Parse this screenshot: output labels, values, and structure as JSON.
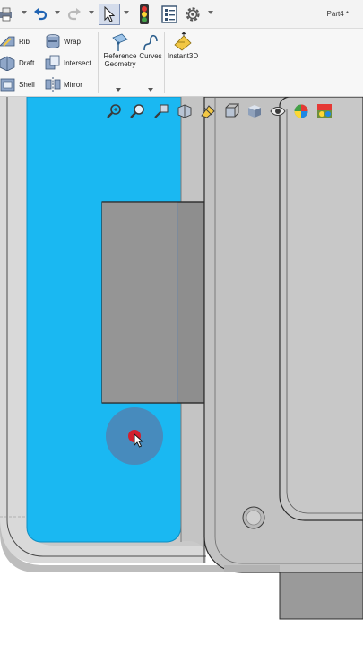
{
  "window": {
    "document_title": "Part4 *"
  },
  "toolbar": {
    "items": [
      {
        "name": "print-icon"
      },
      {
        "name": "undo-icon"
      },
      {
        "name": "redo-icon"
      },
      {
        "name": "select-icon"
      },
      {
        "name": "rebuild-icon"
      },
      {
        "name": "file-properties-icon"
      },
      {
        "name": "options-gear-icon"
      }
    ]
  },
  "ribbon": {
    "rib_label": "Rib",
    "draft_label": "Draft",
    "shell_label": "Shell",
    "wrap_label": "Wrap",
    "intersect_label": "Intersect",
    "mirror_label": "Mirror",
    "reference_geometry_line1": "Reference",
    "reference_geometry_line2": "Geometry",
    "curves_label": "Curves",
    "instant3d_label": "Instant3D"
  },
  "heads_up_toolbar": {
    "icons": [
      "zoom-to-fit-icon",
      "zoom-to-area-icon",
      "previous-view-icon",
      "section-view-icon",
      "dynamic-annotation-icon",
      "view-orientation-icon",
      "display-style-icon",
      "hide-show-items-icon",
      "edit-appearance-icon",
      "apply-scene-icon"
    ]
  },
  "colors": {
    "selected_face": "#1ab8f2",
    "model_gray": "#c5c5c5",
    "edge": "#2b2b2b",
    "cursor_dot": "#d21f2e"
  }
}
